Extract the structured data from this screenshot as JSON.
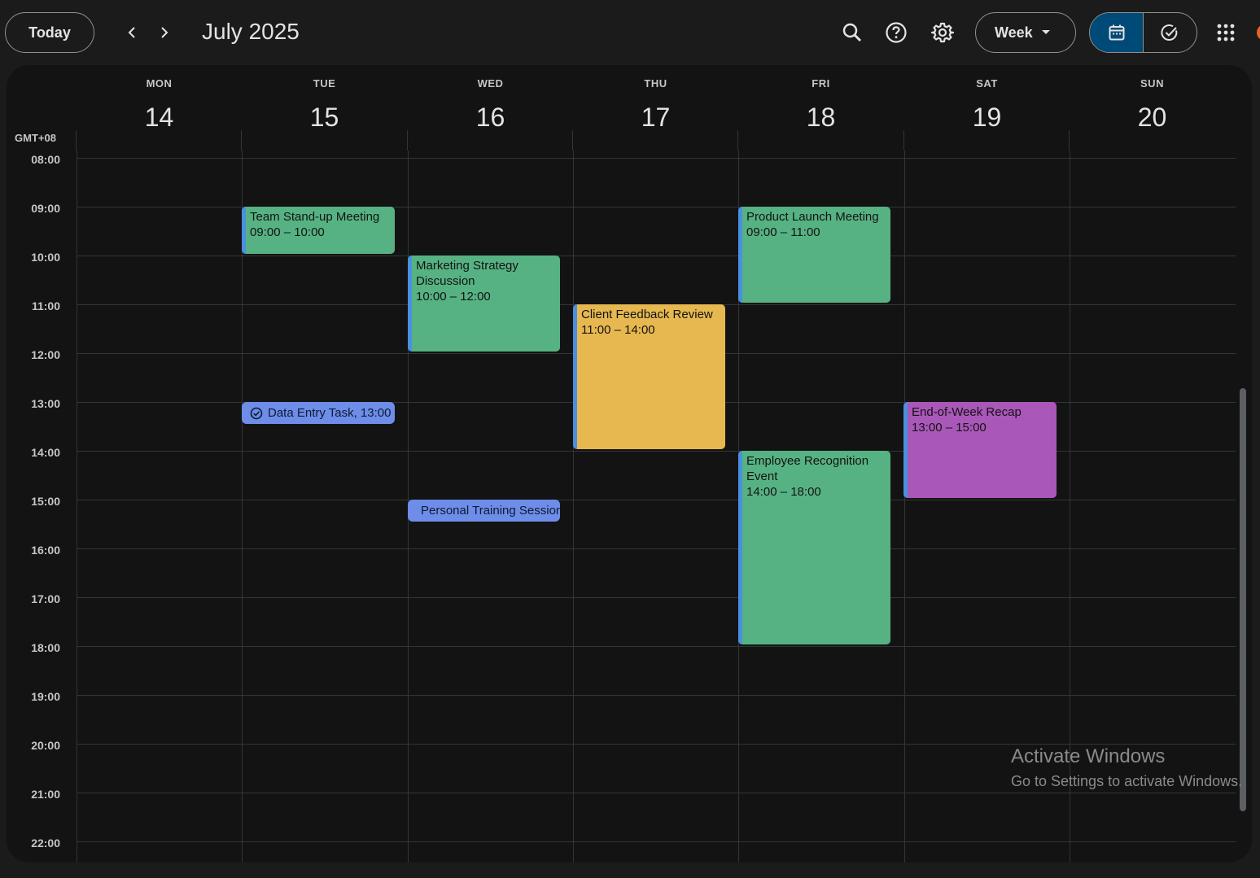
{
  "toolbar": {
    "today_label": "Today",
    "month_title": "July 2025",
    "view_label": "Week"
  },
  "calendar": {
    "timezone": "GMT+08",
    "days": [
      {
        "name": "MON",
        "num": "14"
      },
      {
        "name": "TUE",
        "num": "15"
      },
      {
        "name": "WED",
        "num": "16"
      },
      {
        "name": "THU",
        "num": "17"
      },
      {
        "name": "FRI",
        "num": "18"
      },
      {
        "name": "SAT",
        "num": "19"
      },
      {
        "name": "SUN",
        "num": "20"
      }
    ],
    "hours": [
      "08:00",
      "09:00",
      "10:00",
      "11:00",
      "12:00",
      "13:00",
      "14:00",
      "15:00",
      "16:00",
      "17:00",
      "18:00",
      "19:00",
      "20:00",
      "21:00",
      "22:00"
    ],
    "events": [
      {
        "title": "Team Stand-up Meeting",
        "time": "09:00 – 10:00",
        "color": "#56b283"
      },
      {
        "title": "Marketing Strategy Discussion",
        "time": "10:00 – 12:00",
        "color": "#56b283"
      },
      {
        "title": "Client Feedback Review",
        "time": "11:00 – 14:00",
        "color": "#e6b84f"
      },
      {
        "title": "Product Launch Meeting",
        "time": "09:00 – 11:00",
        "color": "#56b283"
      },
      {
        "title": "Employee Recognition Event",
        "time": "14:00 – 18:00",
        "color": "#56b283"
      },
      {
        "title": "End-of-Week Recap",
        "time": "13:00 – 15:00",
        "color": "#a957b8"
      }
    ],
    "tasks": [
      {
        "label": "Data Entry Task, 13:00"
      },
      {
        "label": "Personal Training Session"
      }
    ]
  },
  "watermark": {
    "line1": "Activate Windows",
    "line2": "Go to Settings to activate Windows."
  },
  "colors": {
    "accent_selected": "#004a77",
    "event_edge": "#4a8fe0",
    "task": "#6d8de8"
  }
}
